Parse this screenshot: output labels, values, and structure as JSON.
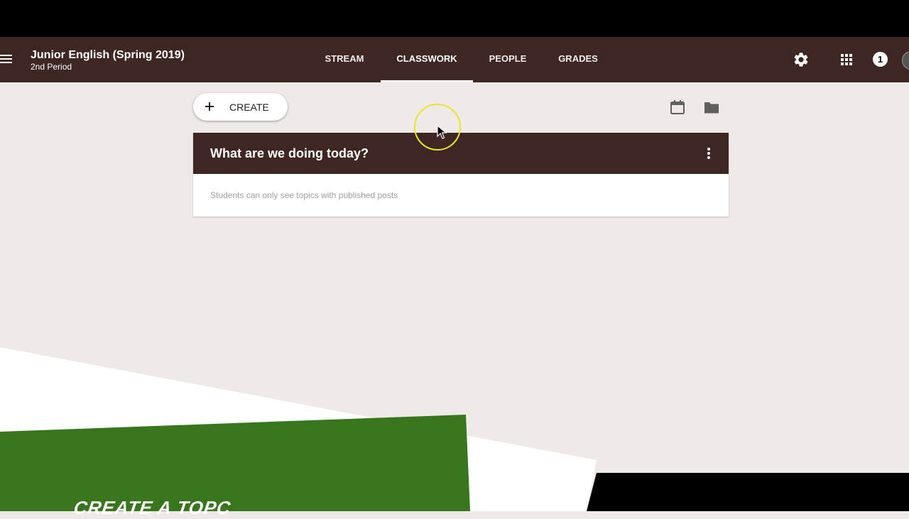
{
  "header": {
    "class_title": "Junior English (Spring 2019)",
    "class_subtitle": "2nd Period",
    "tabs": [
      {
        "label": "STREAM",
        "active": false
      },
      {
        "label": "CLASSWORK",
        "active": true
      },
      {
        "label": "PEOPLE",
        "active": false
      },
      {
        "label": "GRADES",
        "active": false
      }
    ],
    "notification_count": "1",
    "icons": [
      "menu-icon",
      "gear-icon",
      "apps-grid-icon",
      "avatar"
    ]
  },
  "toolbar": {
    "create_label": "CREATE",
    "icons": [
      "plus-icon",
      "calendar-icon",
      "folder-icon"
    ]
  },
  "topic": {
    "title": "What are we doing today?",
    "note": "Students can only see topics with published posts",
    "icons": [
      "more-vert-icon"
    ]
  },
  "overlay": {
    "banner_text": "CREATE A TOPC"
  },
  "colors": {
    "appbar": "#3e2723",
    "background": "#efe9e8",
    "banner_green": "#38761d",
    "cursor_ring": "#e9e430"
  }
}
